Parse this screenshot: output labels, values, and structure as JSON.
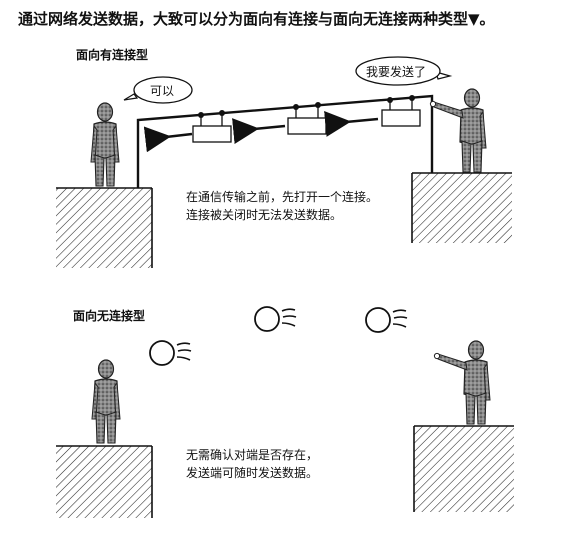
{
  "heading": "通过网络发送数据，大致可以分为面向有连接与面向无连接两种类型",
  "heading_mark": "▼。",
  "connected": {
    "label": "面向有连接型",
    "sender_bubble": "我要发送了",
    "receiver_bubble": "可以",
    "caption_line1": "在通信传输之前，先打开一个连接。",
    "caption_line2": "连接被关闭时无法发送数据。"
  },
  "connectionless": {
    "label": "面向无连接型",
    "caption_line1": "无需确认对端是否存在，",
    "caption_line2": "发送端可随时发送数据。"
  }
}
